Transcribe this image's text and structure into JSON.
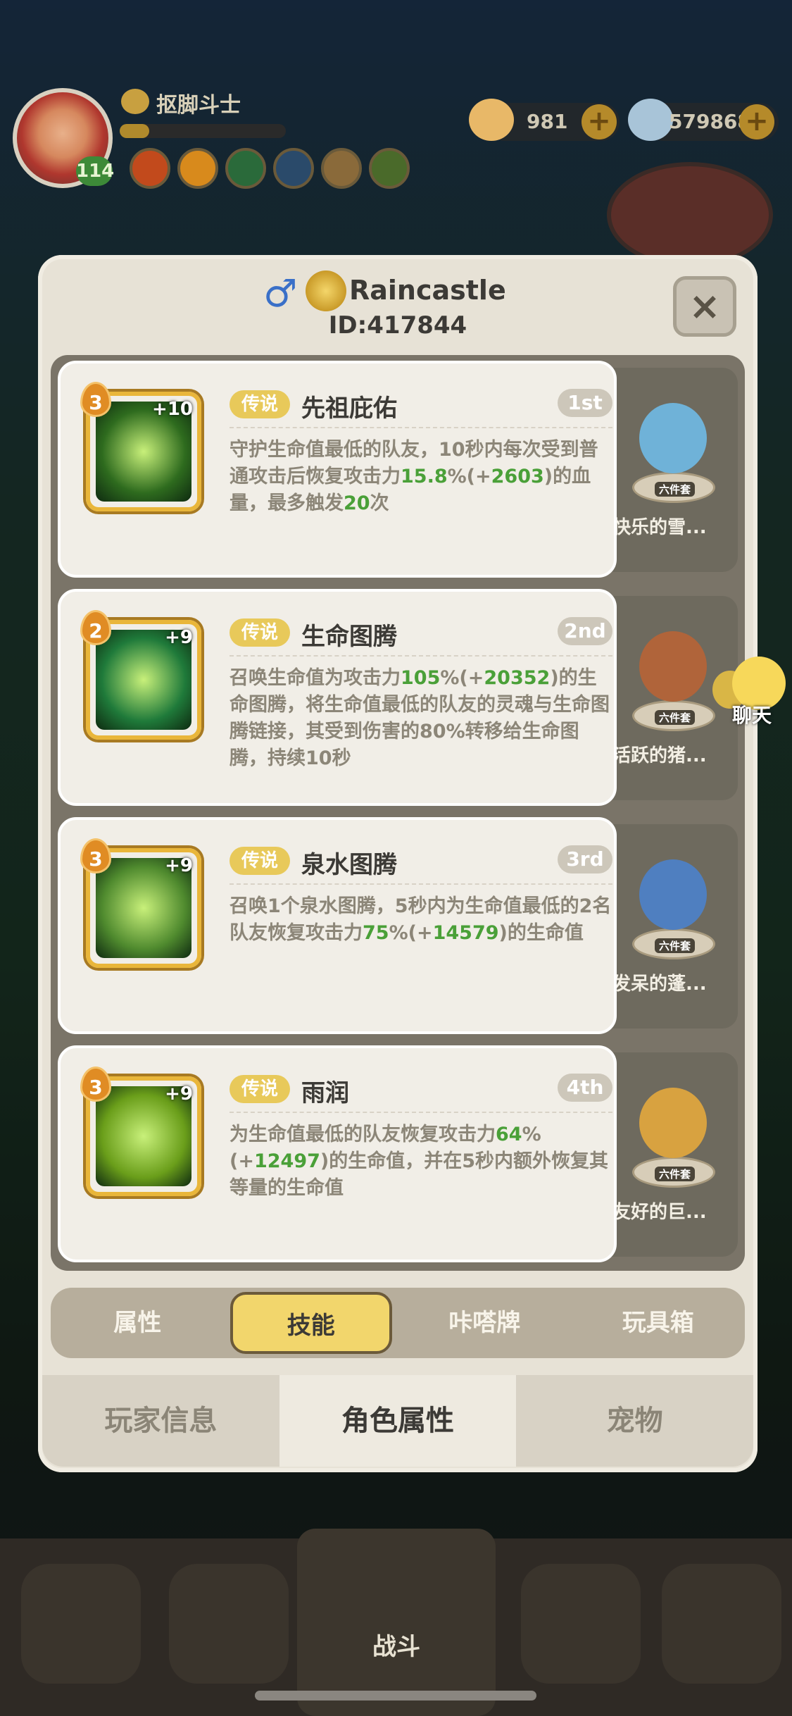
{
  "player": {
    "name": "抠脚斗士",
    "level": "114",
    "xp_fraction": 0.18
  },
  "currency": [
    {
      "icon": "shell-icon",
      "value": "981"
    },
    {
      "icon": "gem-icon",
      "value": "579868"
    }
  ],
  "profile": {
    "gender_icon": "male-icon",
    "nickname": "Raincastle",
    "id": "ID:417844"
  },
  "skills": [
    {
      "stars": "3",
      "plus": "+10",
      "tier": "传说",
      "name": "先祖庇佑",
      "rank": "1st",
      "desc": [
        {
          "t": "守护生命值最低的队友，10秒内每次受到普通攻击后恢复攻击力",
          "g": false
        },
        {
          "t": "15.8",
          "g": true
        },
        {
          "t": "%(+",
          "g": false
        },
        {
          "t": "2603",
          "g": true
        },
        {
          "t": ")的血量，最多触发",
          "g": false
        },
        {
          "t": "20",
          "g": true
        },
        {
          "t": "次",
          "g": false
        }
      ],
      "icon_color": "#2e6b1e",
      "pet": "快乐的雪...",
      "pet_color": "#6fb2d8"
    },
    {
      "stars": "2",
      "plus": "+9",
      "tier": "传说",
      "name": "生命图腾",
      "rank": "2nd",
      "desc": [
        {
          "t": "召唤生命值为攻击力",
          "g": false
        },
        {
          "t": "105",
          "g": true
        },
        {
          "t": "%(+",
          "g": false
        },
        {
          "t": "20352",
          "g": true
        },
        {
          "t": ")的生命图腾，将生命值最低的队友的灵魂与生命图腾链接，其受到伤害的80%转移给生命图腾，持续10秒",
          "g": false
        }
      ],
      "icon_color": "#1f7a3a",
      "pet": "活跃的猪...",
      "pet_color": "#b0643a"
    },
    {
      "stars": "3",
      "plus": "+9",
      "tier": "传说",
      "name": "泉水图腾",
      "rank": "3rd",
      "desc": [
        {
          "t": "召唤1个泉水图腾，5秒内为生命值最低的2名队友恢复攻击力",
          "g": false
        },
        {
          "t": "75",
          "g": true
        },
        {
          "t": "%(+",
          "g": false
        },
        {
          "t": "14579",
          "g": true
        },
        {
          "t": ")的生命值",
          "g": false
        }
      ],
      "icon_color": "#4f8a2e",
      "pet": "发呆的蓬...",
      "pet_color": "#4f7fc0"
    },
    {
      "stars": "3",
      "plus": "+9",
      "tier": "传说",
      "name": "雨润",
      "rank": "4th",
      "desc": [
        {
          "t": "为生命值最低的队友恢复攻击力",
          "g": false
        },
        {
          "t": "64",
          "g": true
        },
        {
          "t": "%(+",
          "g": false
        },
        {
          "t": "12497",
          "g": true
        },
        {
          "t": ")的生命值，并在5秒内额外恢复其等量的生命值",
          "g": false
        }
      ],
      "icon_color": "#6a9e1a",
      "pet": "友好的巨...",
      "pet_color": "#d8a240"
    }
  ],
  "pet_set_label": "六件套",
  "sub_tabs": [
    "属性",
    "技能",
    "咔嗒牌",
    "玩具箱"
  ],
  "sub_tab_active": 1,
  "main_tabs": [
    "玩家信息",
    "角色属性",
    "宠物"
  ],
  "main_tab_active": 1,
  "chat_label": "聊天",
  "close_label": "×",
  "nav": {
    "battle_label": "战斗"
  }
}
